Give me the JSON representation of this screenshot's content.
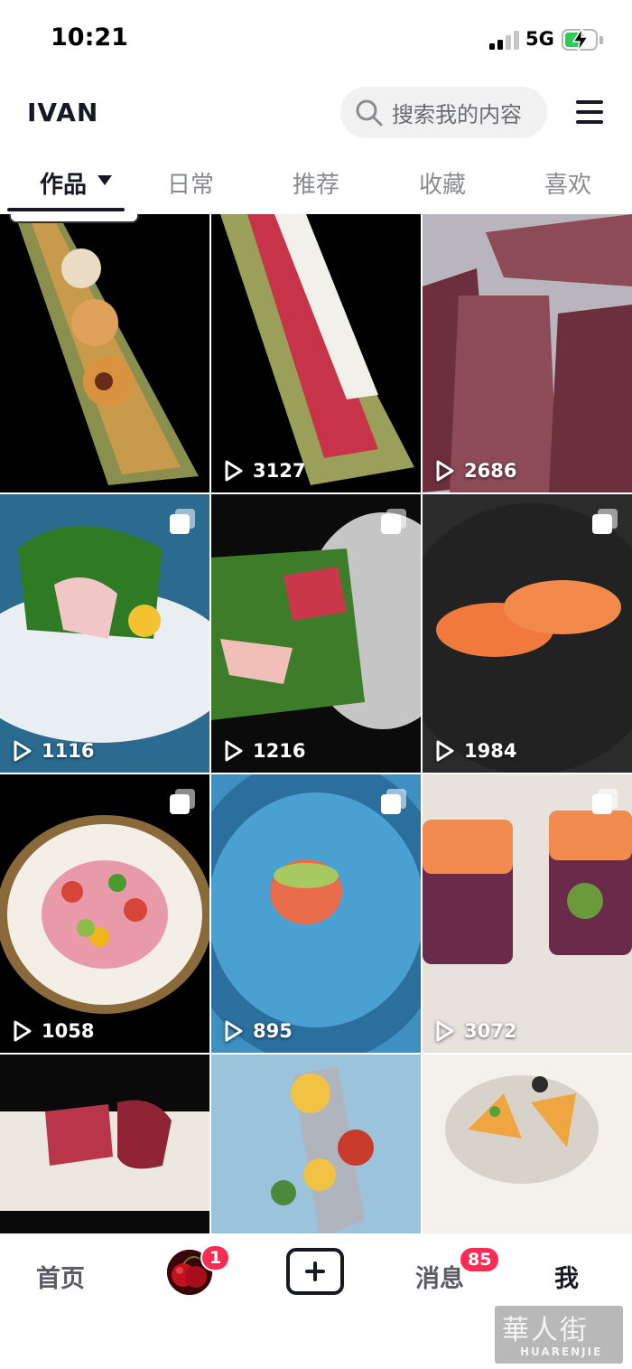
{
  "status_bar": {
    "time": "10:21",
    "network": "5G",
    "battery_level": 0.62,
    "battery_charging": true
  },
  "header": {
    "username": "IVAN",
    "search_placeholder": "搜索我的内容",
    "search_icon": "search-icon",
    "menu_icon": "hamburger-menu-icon"
  },
  "tabs": [
    {
      "label": "作品",
      "active": true,
      "has_dropdown": true
    },
    {
      "label": "日常",
      "active": false
    },
    {
      "label": "推荐",
      "active": false
    },
    {
      "label": "收藏",
      "active": false
    },
    {
      "label": "喜欢",
      "active": false
    }
  ],
  "grid": [
    {
      "subject": "sushi-rolls-on-green-plate",
      "pinned": true,
      "multi_image": false,
      "plays": "",
      "colors": {
        "bg": "#000000",
        "a": "#8a8f4e",
        "b": "#c89a4c"
      }
    },
    {
      "subject": "tuna-rolls-with-cheese",
      "pinned": false,
      "multi_image": false,
      "plays": "3127",
      "colors": {
        "bg": "#000000",
        "a": "#9aa05a",
        "b": "#c7344a"
      }
    },
    {
      "subject": "raw-tuna-blocks",
      "pinned": false,
      "multi_image": false,
      "plays": "2686",
      "colors": {
        "bg": "#b9b5bc",
        "a": "#6b2f3d",
        "b": "#8d4a57"
      }
    },
    {
      "subject": "sashimi-on-ice",
      "pinned": false,
      "multi_image": true,
      "plays": "1116",
      "colors": {
        "bg": "#2a6b8f",
        "a": "#e9eef2",
        "b": "#2f7a25"
      }
    },
    {
      "subject": "sashimi-platter-dry-ice",
      "pinned": false,
      "multi_image": true,
      "plays": "1216",
      "colors": {
        "bg": "#0b0b0b",
        "a": "#d9d9d9",
        "b": "#3d7d2a"
      }
    },
    {
      "subject": "salmon-nigiri",
      "pinned": false,
      "multi_image": true,
      "plays": "1984",
      "colors": {
        "bg": "#2b2b2b",
        "a": "#f07a3e",
        "b": "#1a1a1a"
      }
    },
    {
      "subject": "poke-bowl",
      "pinned": false,
      "multi_image": true,
      "plays": "1058",
      "colors": {
        "bg": "#000000",
        "a": "#f3efe6",
        "b": "#d6453a"
      }
    },
    {
      "subject": "salmon-tartare-blue-plate",
      "pinned": false,
      "multi_image": true,
      "plays": "895",
      "colors": {
        "bg": "#3f8fc0",
        "a": "#2a6f9e",
        "b": "#e86b4a"
      }
    },
    {
      "subject": "salmon-purple-rice-roll",
      "pinned": false,
      "multi_image": true,
      "plays": "3072",
      "colors": {
        "bg": "#e8e2dc",
        "a": "#f08a4e",
        "b": "#6a2a4a"
      }
    },
    {
      "subject": "tuna-cutting-board",
      "pinned": false,
      "multi_image": false,
      "plays": "",
      "colors": {
        "bg": "#0a0a0a",
        "a": "#ece8e0",
        "b": "#b8354a"
      }
    },
    {
      "subject": "fish-with-aioli-blue-plate",
      "pinned": false,
      "multi_image": false,
      "plays": "",
      "colors": {
        "bg": "#9cc3dc",
        "a": "#f2c244",
        "b": "#c83a2a"
      }
    },
    {
      "subject": "crudo-with-citrus",
      "pinned": false,
      "multi_image": false,
      "plays": "",
      "colors": {
        "bg": "#f4f1ec",
        "a": "#f0a640",
        "b": "#2b2b2b"
      }
    }
  ],
  "bottom_nav": {
    "home": "首页",
    "friends_badge": "1",
    "add_icon": "plus-icon",
    "messages": "消息",
    "messages_badge": "85",
    "me": "我"
  },
  "watermark": {
    "main": "華人街",
    "sub": "HUARENJIE"
  }
}
